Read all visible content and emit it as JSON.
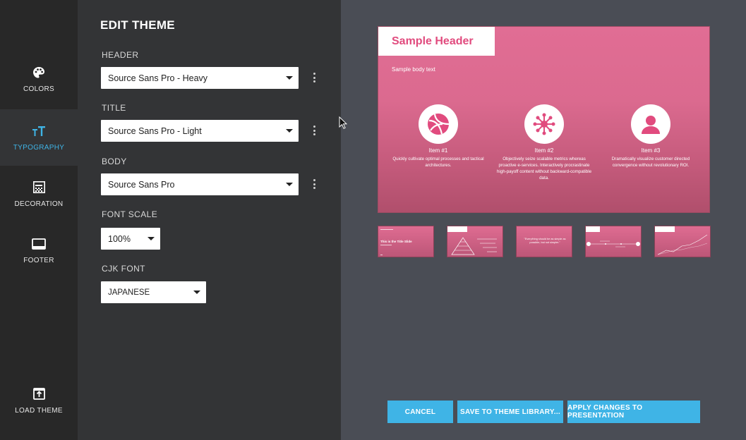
{
  "rail": {
    "items": [
      {
        "label": "COLORS",
        "icon": "palette-icon"
      },
      {
        "label": "TYPOGRAPHY",
        "icon": "typography-icon",
        "active": true
      },
      {
        "label": "DECORATION",
        "icon": "decoration-icon"
      },
      {
        "label": "FOOTER",
        "icon": "footer-icon"
      }
    ],
    "load_theme": {
      "label": "LOAD THEME",
      "icon": "load-theme-icon"
    }
  },
  "editor": {
    "title": "EDIT THEME",
    "header": {
      "label": "HEADER",
      "value": "Source Sans Pro - Heavy"
    },
    "title_font": {
      "label": "TITLE",
      "value": "Source Sans Pro - Light"
    },
    "body": {
      "label": "BODY",
      "value": "Source Sans Pro"
    },
    "font_scale": {
      "label": "FONT SCALE",
      "value": "100%"
    },
    "cjk_font": {
      "label": "CJK FONT",
      "value": "JAPANESE"
    }
  },
  "preview": {
    "header": "Sample Header",
    "body_text": "Sample body text",
    "items": [
      {
        "title": "Item #1",
        "desc": "Quickly cultivate optimal processes and tactical architectures.",
        "icon": "ball-icon"
      },
      {
        "title": "Item #2",
        "desc": "Objectively seize scalable metrics whereas proactive e-services. Interactively procrastinate high-payoff content without backward-compatible data.",
        "icon": "network-icon"
      },
      {
        "title": "Item #3",
        "desc": "Dramatically visualize customer directed convergence without revolutionary ROI.",
        "icon": "person-icon"
      }
    ],
    "thumbnails": [
      {
        "text": "This is the Title Slide"
      },
      {
        "text": ""
      },
      {
        "text": "\"Everything should be as simple as possible, but not simpler.\""
      },
      {
        "text": ""
      },
      {
        "text": ""
      }
    ]
  },
  "actions": {
    "cancel": "CANCEL",
    "save": "SAVE TO THEME LIBRARY...",
    "apply": "APPLY CHANGES TO PRESENTATION"
  },
  "colors": {
    "accent": "#3fb4e6",
    "slide_pink": "#e16d94",
    "header_pink": "#e14b7e"
  }
}
